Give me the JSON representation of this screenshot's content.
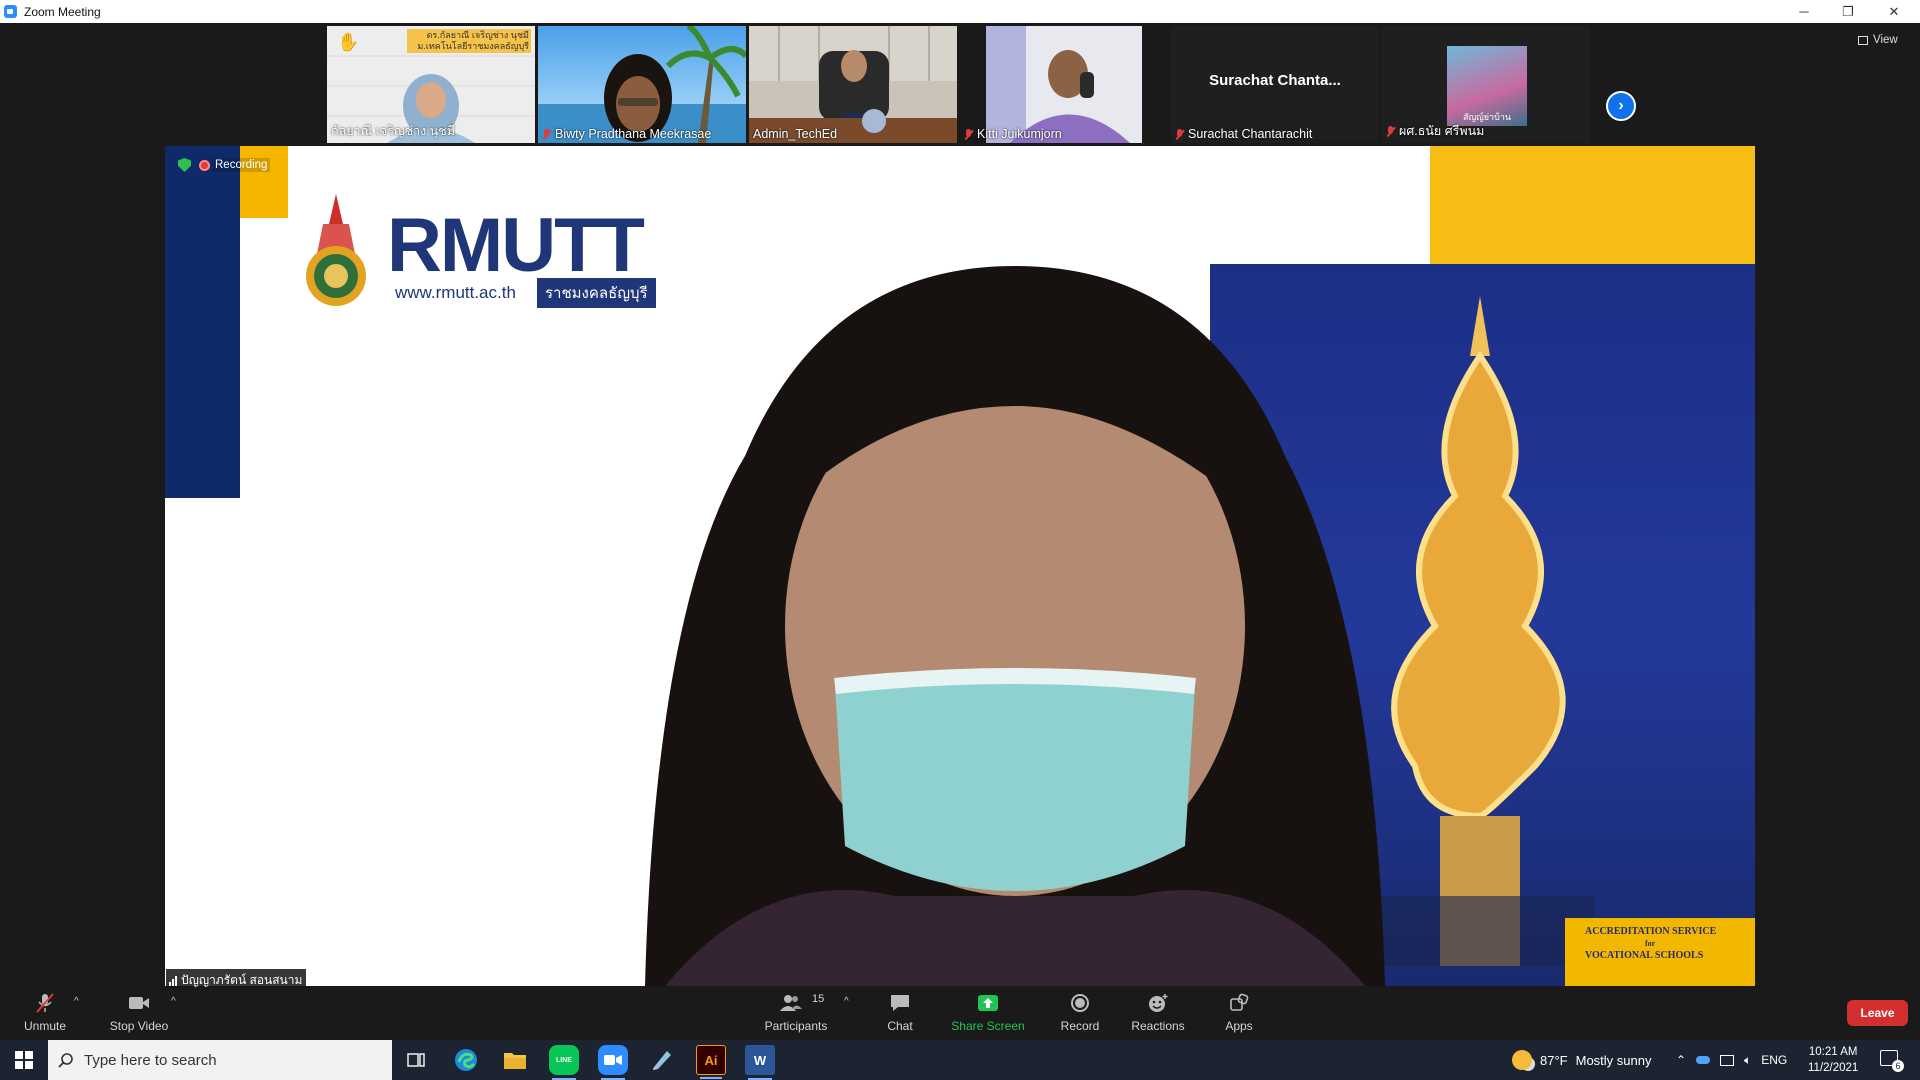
{
  "window": {
    "title": "Zoom Meeting",
    "controls": {
      "minimize": "─",
      "restore": "❐",
      "close": "✕"
    }
  },
  "participants_strip": {
    "tiles": [
      {
        "name": "กัลยาณี เจริญช่าง นุชมี",
        "muted": false,
        "raised_hand": true,
        "banner_line1": "ดร.กัลยาณี เจริญช่าง นุชมี",
        "banner_line2": "ม.เทคโนโลยีราชมงคลธัญบุรี"
      },
      {
        "name": "Biwty Pradthana Meekrasae",
        "muted": true
      },
      {
        "name": "Admin_TechEd",
        "muted": false
      },
      {
        "name": "Kitti Juikumjorn",
        "muted": true
      },
      {
        "name": "Surachat Chantarachit",
        "muted": true,
        "display_text": "Surachat  Chanta..."
      },
      {
        "name": "ผศ.ธนัย  ศรีพนม",
        "muted": true,
        "avatar_caption": "สัญญ์ย่าบ้าน"
      }
    ],
    "next_icon": "chevron-right-icon",
    "view_label": "View"
  },
  "main_video": {
    "brand": "RMUTT",
    "url": "www.rmutt.ac.th",
    "thai_tag": "ราชมงคลธัญบุรี",
    "corner_line1": "ACCREDITATION SERVICE",
    "corner_line2": "for",
    "corner_line3": "VOCATIONAL SCHOOLS",
    "recording_label": "Recording",
    "speaker_name": "ปัญญาภรัตน์ สอนสนาม"
  },
  "toolbar": {
    "unmute": "Unmute",
    "stop_video": "Stop Video",
    "participants": "Participants",
    "participant_count": "15",
    "chat": "Chat",
    "share_screen": "Share Screen",
    "record": "Record",
    "reactions": "Reactions",
    "apps": "Apps",
    "leave": "Leave",
    "caret": "^"
  },
  "taskbar": {
    "search_placeholder": "Type here to search",
    "apps": [
      "task-view",
      "edge",
      "file-explorer",
      "line",
      "zoom",
      "notes",
      "illustrator",
      "word"
    ],
    "illustrator_label": "Ai",
    "word_label": "W",
    "line_label": "LINE",
    "weather_temp": "87°F",
    "weather_desc": "Mostly sunny",
    "language": "ENG",
    "time": "10:21 AM",
    "date": "11/2/2021",
    "notification_count": "6"
  },
  "colors": {
    "zoom_blue": "#0e72ed",
    "share_green": "#23c552",
    "leave_red": "#d32f2f",
    "rmutt_navy": "#1f3779",
    "rmutt_yellow": "#f8bd15"
  }
}
